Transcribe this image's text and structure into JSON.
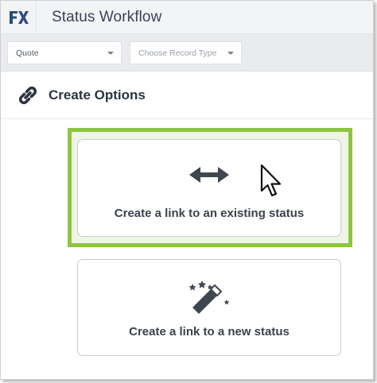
{
  "app": {
    "logo_text": "FX",
    "title": "Status Workflow"
  },
  "filters": {
    "object_select": {
      "value": "Quote",
      "icon": "chevron-down-icon"
    },
    "record_type_select": {
      "placeholder": "Choose Record Type",
      "icon": "chevron-down-icon"
    }
  },
  "section": {
    "icon": "link-icon",
    "title": "Create Options"
  },
  "options": [
    {
      "label": "Create a link to an existing status",
      "icon": "double-arrow-icon",
      "highlighted": true
    },
    {
      "label": "Create a link to a new status",
      "icon": "magic-wand-icon",
      "highlighted": false
    }
  ],
  "colors": {
    "highlight_border": "#8dc540",
    "logo_blue": "#2c4a80",
    "text_dark": "#2d3440"
  }
}
